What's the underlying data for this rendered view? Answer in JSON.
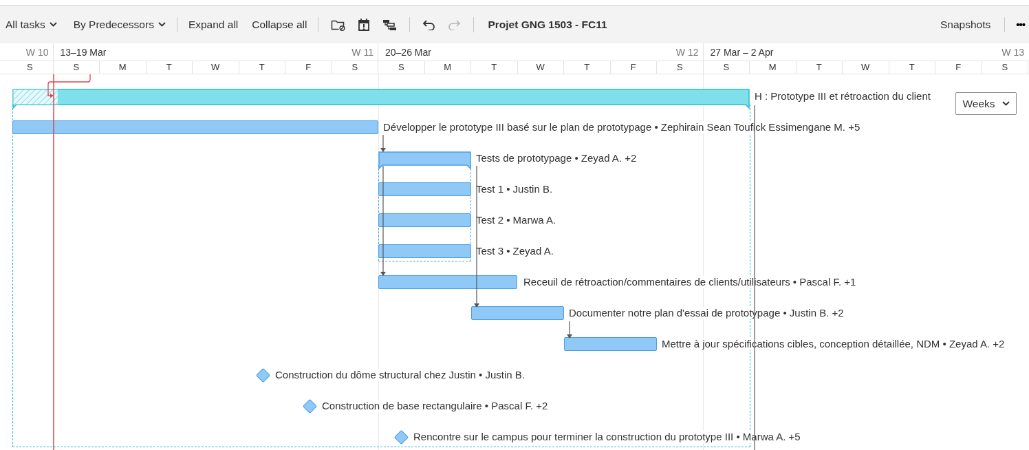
{
  "toolbar": {
    "filter": {
      "label": "All tasks"
    },
    "grouping": {
      "label": "By Predecessors"
    },
    "expand": "Expand all",
    "collapse": "Collapse all",
    "history": [
      {
        "kind": "undo",
        "disabled": false
      },
      {
        "kind": "redo",
        "disabled": true
      }
    ],
    "project_title": "Projet GNG 1503 - FC11",
    "snapshots": "Snapshots",
    "more": "•••"
  },
  "timeline": {
    "weeks": [
      {
        "week": "W 10"
      },
      {
        "range": "13–19 Mar",
        "week": "W 11"
      },
      {
        "range": "20–26 Mar",
        "week": "W 12"
      },
      {
        "range": "27 Mar – 2 Apr",
        "week": "W 13"
      }
    ],
    "days": [
      "S",
      "S",
      "M",
      "T",
      "W",
      "T",
      "F",
      "S",
      "S",
      "M",
      "T",
      "W",
      "T",
      "F",
      "S",
      "S",
      "M",
      "T",
      "W",
      "T",
      "F",
      "S"
    ]
  },
  "zoom": {
    "value": "Weeks"
  },
  "tasks": [
    {
      "kind": "summary",
      "label": "H : Prototype III et rétroaction du client",
      "level": 0.06,
      "expanded": true,
      "children": [
        {
          "kind": "task",
          "label": "Développer le prototype III basé sur le plan de prototypage • Zephirain Sean Toufick Essimengane M. +5"
        },
        {
          "kind": "summary",
          "label": "Tests de prototypage • Zeyad A. +2",
          "expanded": true,
          "children": [
            {
              "kind": "task",
              "label": "Test 1 • Justin B."
            },
            {
              "kind": "task",
              "label": "Test 2 • Marwa A."
            },
            {
              "kind": "task",
              "label": "Test 3 • Zeyad A."
            }
          ]
        },
        {
          "kind": "task",
          "label": "Receuil de rétroaction/commentaires de clients/utilisateurs • Pascal F. +1"
        },
        {
          "kind": "task",
          "label": "Documenter notre plan d'essai de prototypage • Justin B. +2"
        },
        {
          "kind": "task",
          "label": "Mettre à jour spécifications cibles, conception détaillée, NDM • Zeyad A. +2"
        },
        {
          "kind": "milestone",
          "label": "Construction du dôme structural chez Justin • Justin B."
        },
        {
          "kind": "milestone",
          "label": "Construction de base rectangulaire • Pascal F. +2"
        },
        {
          "kind": "milestone",
          "label": "Rencontre sur le campus pour terminer la construction du prototype III • Marwa A. +5"
        }
      ]
    }
  ]
}
